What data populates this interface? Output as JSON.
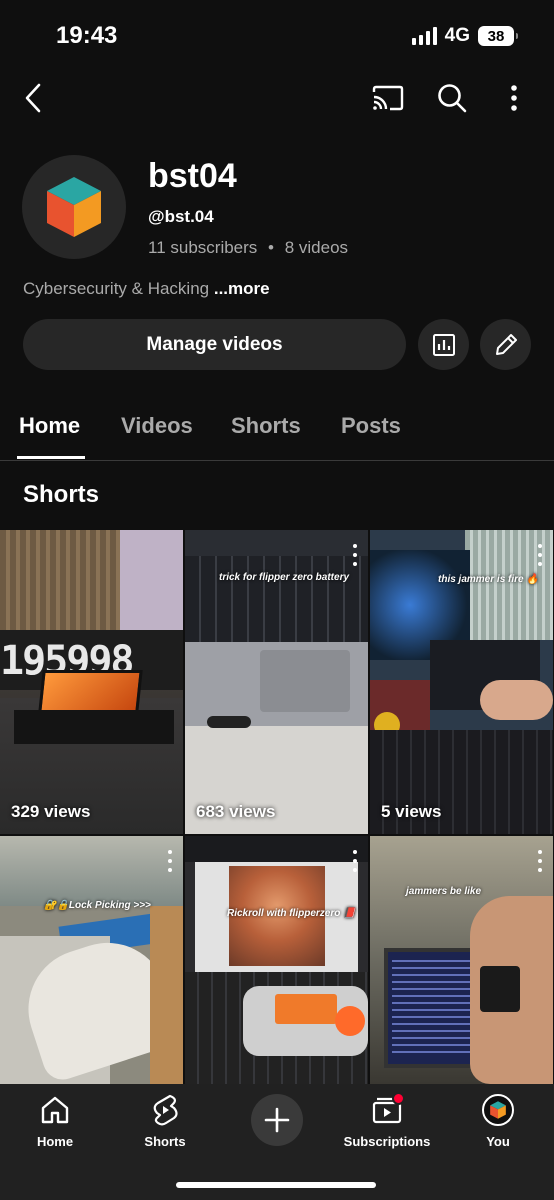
{
  "status_bar": {
    "time": "19:43",
    "network": "4G",
    "battery": "38"
  },
  "channel": {
    "name": "bst04",
    "handle": "@bst.04",
    "subscribers": "11 subscribers",
    "separator": "•",
    "videos": "8 videos",
    "description": "Cybersecurity & Hacking",
    "more_label": "...more"
  },
  "actions": {
    "manage_label": "Manage videos"
  },
  "tabs": [
    {
      "label": "Home",
      "active": true
    },
    {
      "label": "Videos",
      "active": false
    },
    {
      "label": "Shorts",
      "active": false
    },
    {
      "label": "Posts",
      "active": false
    }
  ],
  "shorts_section": {
    "title": "Shorts",
    "items": [
      {
        "views": "329 views",
        "caption": ""
      },
      {
        "views": "683 views",
        "caption": "trick for flipper zero battery"
      },
      {
        "views": "5 views",
        "caption": "this jammer is fire 🔥"
      },
      {
        "views": "",
        "caption": "🔐🔒Lock Picking >>>"
      },
      {
        "views": "",
        "caption": "Rickroll with flipperzero 📕"
      },
      {
        "views": "",
        "caption": "jammers be like"
      }
    ]
  },
  "bottom_nav": {
    "items": [
      {
        "label": "Home",
        "icon": "home-icon"
      },
      {
        "label": "Shorts",
        "icon": "shorts-icon"
      },
      {
        "label": "Subscriptions",
        "icon": "subscriptions-icon"
      },
      {
        "label": "You",
        "icon": "account-avatar-icon"
      }
    ]
  },
  "colors": {
    "background": "#0f0f0f",
    "surface": "#272727",
    "nav_background": "#212121",
    "accent": "#ff0033"
  }
}
